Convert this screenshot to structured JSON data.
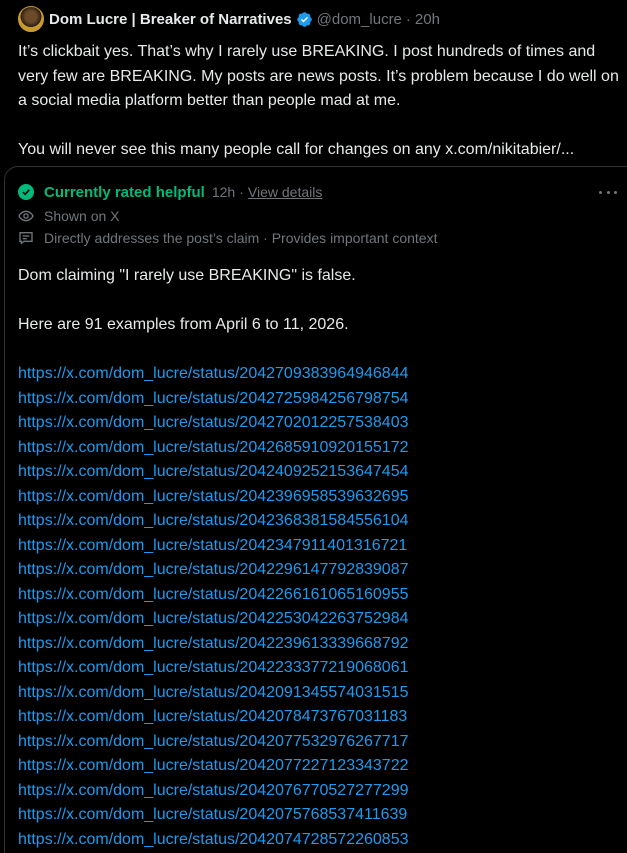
{
  "post": {
    "display_name": "Dom Lucre | Breaker of Narratives",
    "handle": "@dom_lucre",
    "separator": "·",
    "time": "20h",
    "paragraphs": [
      "It’s clickbait yes. That’s why I rarely use BREAKING. I post hundreds of times and very few are BREAKING. My posts are news posts. It’s problem because I do well on a social media platform better than people mad at me.",
      "You will never see this many people call for changes on any x.com/nikitabier/..."
    ],
    "icons": {
      "avatar": "avatar",
      "verified": "verified-badge-icon"
    }
  },
  "note": {
    "status_label": "Currently rated helpful",
    "time": "12h",
    "separator": "·",
    "view_details": "View details",
    "shown_on": "Shown on X",
    "reasons": "Directly addresses the post’s claim · Provides important context",
    "claim": "Dom claiming \"I rarely use BREAKING\" is false.",
    "intro": "Here are 91 examples from April 6 to 11, 2026.",
    "links": [
      "https://x.com/dom_lucre/status/2042709383964946844",
      "https://x.com/dom_lucre/status/2042725984256798754",
      "https://x.com/dom_lucre/status/2042702012257538403",
      "https://x.com/dom_lucre/status/2042685910920155172",
      "https://x.com/dom_lucre/status/2042409252153647454",
      "https://x.com/dom_lucre/status/2042396958539632695",
      "https://x.com/dom_lucre/status/2042368381584556104",
      "https://x.com/dom_lucre/status/2042347911401316721",
      "https://x.com/dom_lucre/status/2042296147792839087",
      "https://x.com/dom_lucre/status/2042266161065160955",
      "https://x.com/dom_lucre/status/2042253042263752984",
      "https://x.com/dom_lucre/status/2042239613339668792",
      "https://x.com/dom_lucre/status/2042233377219068061",
      "https://x.com/dom_lucre/status/2042091345574031515",
      "https://x.com/dom_lucre/status/2042078473767031183",
      "https://x.com/dom_lucre/status/2042077532976267717",
      "https://x.com/dom_lucre/status/2042077227123343722",
      "https://x.com/dom_lucre/status/2042076770527277299",
      "https://x.com/dom_lucre/status/2042075768537411639",
      "https://x.com/dom_lucre/status/2042074728572260853"
    ],
    "icons": {
      "status": "check-circle-icon",
      "more": "more-horizontal-icon",
      "shown": "eye-icon",
      "reasons": "message-box-icon"
    },
    "colors": {
      "helpful": "#00ba7c",
      "link": "#1d9bf0",
      "muted": "#71767b"
    }
  }
}
